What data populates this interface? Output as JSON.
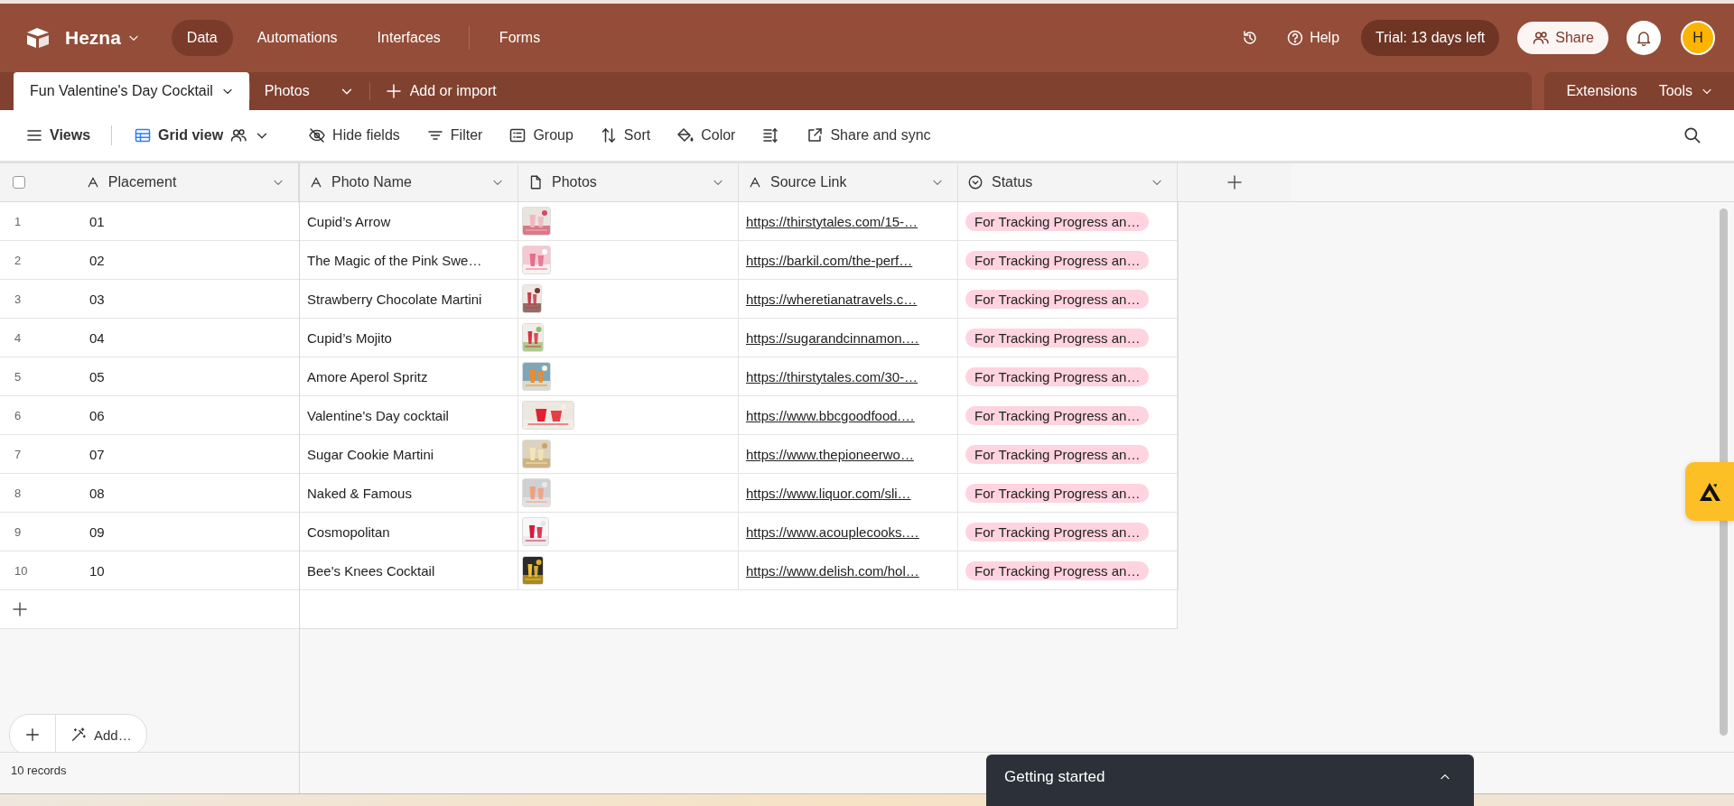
{
  "app": {
    "name": "Hezna"
  },
  "nav": [
    {
      "label": "Data",
      "selected": true
    },
    {
      "label": "Automations",
      "selected": false
    },
    {
      "label": "Interfaces",
      "selected": false
    },
    {
      "label": "Forms",
      "selected": false
    }
  ],
  "header_actions": {
    "help": "Help",
    "trial": "Trial: 13 days left",
    "share": "Share",
    "avatar": "H"
  },
  "table_tabs": [
    {
      "label": "Fun Valentine's Day Cocktail",
      "selected": true
    },
    {
      "label": "Photos",
      "selected": false
    }
  ],
  "add_or_import": "Add or import",
  "right_tabs": [
    "Extensions",
    "Tools"
  ],
  "toolbar": {
    "views": "Views",
    "view_name": "Grid view",
    "items": [
      {
        "kind": "hide",
        "label": "Hide fields"
      },
      {
        "kind": "filter",
        "label": "Filter"
      },
      {
        "kind": "group",
        "label": "Group"
      },
      {
        "kind": "sort",
        "label": "Sort"
      },
      {
        "kind": "color",
        "label": "Color"
      },
      {
        "kind": "row-height"
      },
      {
        "kind": "share",
        "label": "Share and sync"
      }
    ]
  },
  "grid": {
    "select_all": {
      "checked": false
    },
    "columns": [
      {
        "kind": "text",
        "label": "Placement"
      },
      {
        "kind": "text",
        "label": "Photo Name"
      },
      {
        "kind": "attachment",
        "label": "Photos"
      },
      {
        "kind": "text",
        "label": "Source Link"
      },
      {
        "kind": "select",
        "label": "Status"
      }
    ],
    "rows": [
      {
        "number": "1",
        "placement": "01",
        "photo_name": "Cupid’s Arrow",
        "source_link": "https://thirstytales.com/15-…",
        "status": {
          "label": "For Tracking Progress an…",
          "color": "#ffd3df"
        }
      },
      {
        "number": "2",
        "placement": "02",
        "photo_name": "The Magic of the Pink Swe…",
        "source_link": "https://barkil.com/the-perf…",
        "status": {
          "label": "For Tracking Progress an…",
          "color": "#ffd3df"
        }
      },
      {
        "number": "3",
        "placement": "03",
        "photo_name": "Strawberry Chocolate Martini",
        "source_link": "https://wheretianatravels.c…",
        "status": {
          "label": "For Tracking Progress an…",
          "color": "#ffd3df"
        }
      },
      {
        "number": "4",
        "placement": "04",
        "photo_name": "Cupid’s Mojito",
        "source_link": "https://sugarandcinnamon.…",
        "status": {
          "label": "For Tracking Progress an…",
          "color": "#ffd3df"
        }
      },
      {
        "number": "5",
        "placement": "05",
        "photo_name": "Amore Aperol Spritz",
        "source_link": "https://thirstytales.com/30-…",
        "status": {
          "label": "For Tracking Progress an…",
          "color": "#ffd3df"
        }
      },
      {
        "number": "6",
        "placement": "06",
        "photo_name": "Valentine's Day cocktail",
        "source_link": "https://www.bbcgoodfood.…",
        "status": {
          "label": "For Tracking Progress an…",
          "color": "#ffd3df"
        }
      },
      {
        "number": "7",
        "placement": "07",
        "photo_name": "Sugar Cookie Martini",
        "source_link": "https://www.thepioneerwo…",
        "status": {
          "label": "For Tracking Progress an…",
          "color": "#ffd3df"
        }
      },
      {
        "number": "8",
        "placement": "08",
        "photo_name": "Naked & Famous",
        "source_link": "https://www.liquor.com/sli…",
        "status": {
          "label": "For Tracking Progress an…",
          "color": "#ffd3df"
        }
      },
      {
        "number": "9",
        "placement": "09",
        "photo_name": "Cosmopolitan",
        "source_link": "https://www.acouplecooks.…",
        "status": {
          "label": "For Tracking Progress an…",
          "color": "#ffd3df"
        }
      },
      {
        "number": "10",
        "placement": "10",
        "photo_name": "Bee's Knees Cocktail",
        "source_link": "https://www.delish.com/hol…",
        "status": {
          "label": "For Tracking Progress an…",
          "color": "#ffd3df"
        }
      }
    ]
  },
  "add_menu": {
    "label": "Add…"
  },
  "record_count": "10 records",
  "getting_started": "Getting started"
}
